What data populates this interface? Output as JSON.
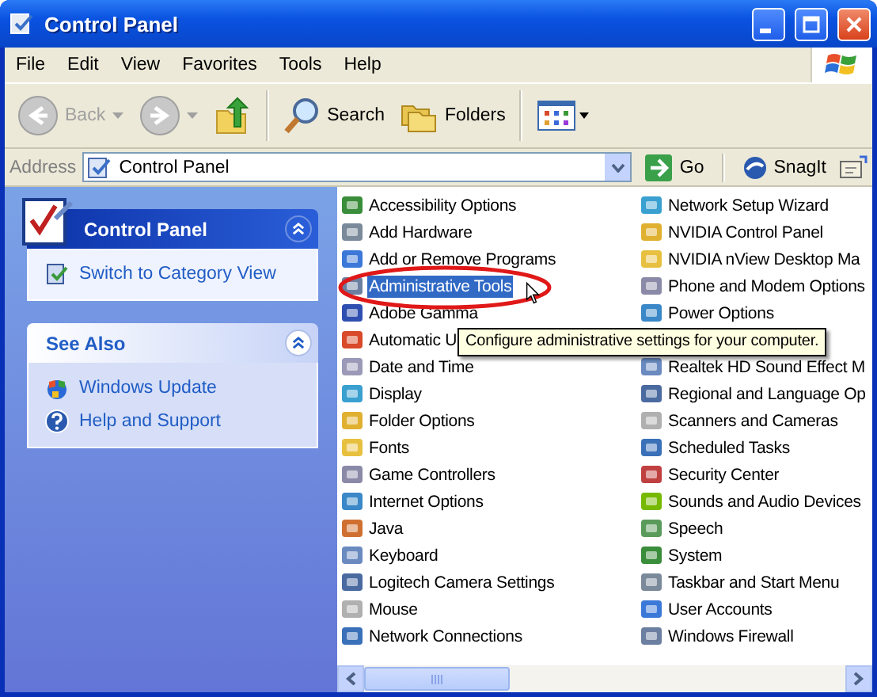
{
  "window": {
    "title": "Control Panel"
  },
  "menu": [
    "File",
    "Edit",
    "View",
    "Favorites",
    "Tools",
    "Help"
  ],
  "toolbar": [
    {
      "kind": "back",
      "label": "Back",
      "disabled": true
    },
    {
      "kind": "forward",
      "disabled": true
    },
    {
      "kind": "up"
    },
    {
      "kind": "search",
      "label": "Search"
    },
    {
      "kind": "folders",
      "label": "Folders"
    },
    {
      "kind": "views"
    }
  ],
  "address": {
    "label": "Address",
    "value": "Control Panel",
    "go": "Go",
    "snagit": "SnagIt"
  },
  "tasks": [
    {
      "kind": "special",
      "title": "Control Panel",
      "expanded": true,
      "links": [
        "Switch to Category View"
      ]
    },
    {
      "kind": "normal",
      "title": "See Also",
      "expanded": true,
      "links": [
        "Windows Update",
        "Help and Support"
      ]
    }
  ],
  "applets": {
    "tooltip": "Configure administrative settings for your computer.",
    "rows": [
      {
        "left": {
          "label": "Accessibility Options",
          "selected": false
        },
        "right": {
          "label": "Network Setup Wizard",
          "selected": false
        }
      },
      {
        "left": {
          "label": "Add Hardware",
          "selected": false
        },
        "right": {
          "label": "NVIDIA Control Panel",
          "selected": false
        }
      },
      {
        "left": {
          "label": "Add or Remove Programs",
          "selected": false
        },
        "right": {
          "label": "NVIDIA nView Desktop Ma",
          "selected": false
        }
      },
      {
        "left": {
          "label": "Administrative Tools",
          "selected": true
        },
        "right": {
          "label": "Phone and Modem Options",
          "selected": false
        }
      },
      {
        "left": {
          "label": "Adobe Gamma",
          "selected": false
        },
        "right": {
          "label": "Power Options",
          "selected": false
        }
      },
      {
        "left": {
          "label": "Automatic U",
          "selected": false
        }
      },
      {
        "left": {
          "label": "Date and Time",
          "selected": false
        },
        "right": {
          "label": "Realtek HD Sound Effect M",
          "selected": false
        }
      },
      {
        "left": {
          "label": "Display",
          "selected": false
        },
        "right": {
          "label": "Regional and Language Op",
          "selected": false
        }
      },
      {
        "left": {
          "label": "Folder Options",
          "selected": false
        },
        "right": {
          "label": "Scanners and Cameras",
          "selected": false
        }
      },
      {
        "left": {
          "label": "Fonts",
          "selected": false
        },
        "right": {
          "label": "Scheduled Tasks",
          "selected": false
        }
      },
      {
        "left": {
          "label": "Game Controllers",
          "selected": false
        },
        "right": {
          "label": "Security Center",
          "selected": false
        }
      },
      {
        "left": {
          "label": "Internet Options",
          "selected": false
        },
        "right": {
          "label": "Sounds and Audio Devices",
          "selected": false
        }
      },
      {
        "left": {
          "label": "Java",
          "selected": false
        },
        "right": {
          "label": "Speech",
          "selected": false
        }
      },
      {
        "left": {
          "label": "Keyboard",
          "selected": false
        },
        "right": {
          "label": "System",
          "selected": false
        }
      },
      {
        "left": {
          "label": "Logitech Camera Settings",
          "selected": false
        },
        "right": {
          "label": "Taskbar and Start Menu",
          "selected": false
        }
      },
      {
        "left": {
          "label": "Mouse",
          "selected": false
        },
        "right": {
          "label": "User Accounts",
          "selected": false
        }
      },
      {
        "left": {
          "label": "Network Connections",
          "selected": false
        },
        "right": {
          "label": "Windows Firewall",
          "selected": false
        }
      }
    ]
  }
}
